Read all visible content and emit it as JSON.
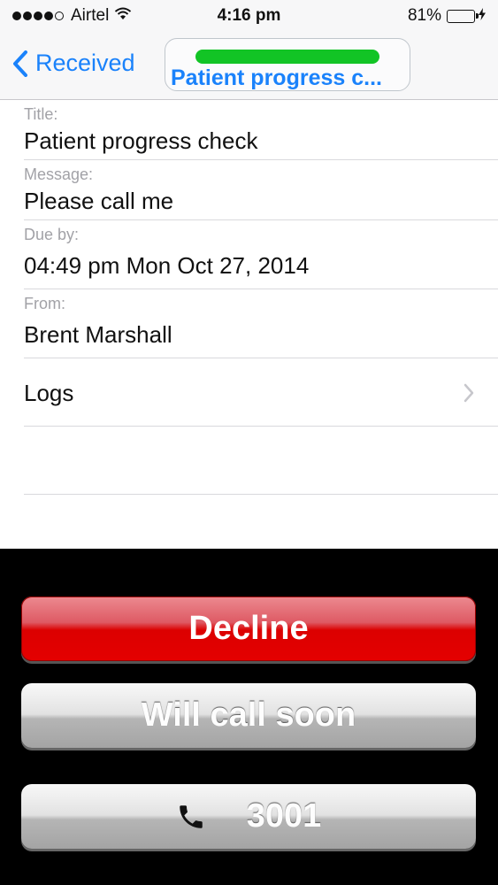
{
  "status_bar": {
    "carrier": "Airtel",
    "time": "4:16 pm",
    "battery_percent": "81%",
    "battery_level": 0.81
  },
  "nav": {
    "back_label": "Received",
    "title": "Patient progress c..."
  },
  "details": {
    "title_label": "Title:",
    "title_value": "Patient progress check",
    "message_label": "Message:",
    "message_value": "Please call me",
    "due_label": "Due by:",
    "due_value": "04:49 pm Mon Oct 27, 2014",
    "from_label": "From:",
    "from_value": "Brent Marshall",
    "logs_label": "Logs"
  },
  "actions": {
    "decline_label": "Decline",
    "will_call_label": "Will call soon",
    "call_number": "3001"
  },
  "colors": {
    "accent": "#1a82fb",
    "decline": "#e40000",
    "battery": "#4cd964",
    "highlight": "#12c425"
  },
  "icons": [
    "wifi-icon",
    "battery-icon",
    "charging-bolt-icon",
    "back-chevron-icon",
    "chevron-right-icon",
    "phone-icon"
  ]
}
